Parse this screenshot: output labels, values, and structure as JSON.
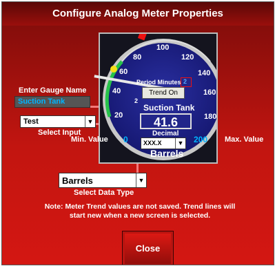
{
  "window": {
    "title": "Configure Analog Meter Properties"
  },
  "labels": {
    "enter_gauge_name": "Enter Gauge Name",
    "select_input": "Select Input",
    "select_data_type": "Select Data Type",
    "min_value": "Min. Value",
    "max_value": "Max. Value"
  },
  "fields": {
    "gauge_name": "Suction Tank",
    "input": "Test",
    "data_type": "Barrels"
  },
  "gauge": {
    "ticks": [
      "20",
      "40",
      "60",
      "80",
      "100",
      "120",
      "140",
      "160",
      "180"
    ],
    "period_minutes_label": "Period Minutes",
    "period_minutes_value": "2",
    "trend_button": "Trend On",
    "small_indicator": "2",
    "name": "Suction Tank",
    "reading": "41.6",
    "decimal_label": "Decimal",
    "decimal_value": "XXX.X",
    "min_value": "0",
    "max_value": "200",
    "units": "Barrels",
    "needle_value": 41.6
  },
  "note": "Note: Meter Trend values are not saved. Trend lines will start new when a new screen is selected.",
  "buttons": {
    "close": "Close"
  },
  "colors": {
    "accent": "#cc1510",
    "gauge_face": "#22268a",
    "gauge_name_field": "#00a0f0"
  }
}
